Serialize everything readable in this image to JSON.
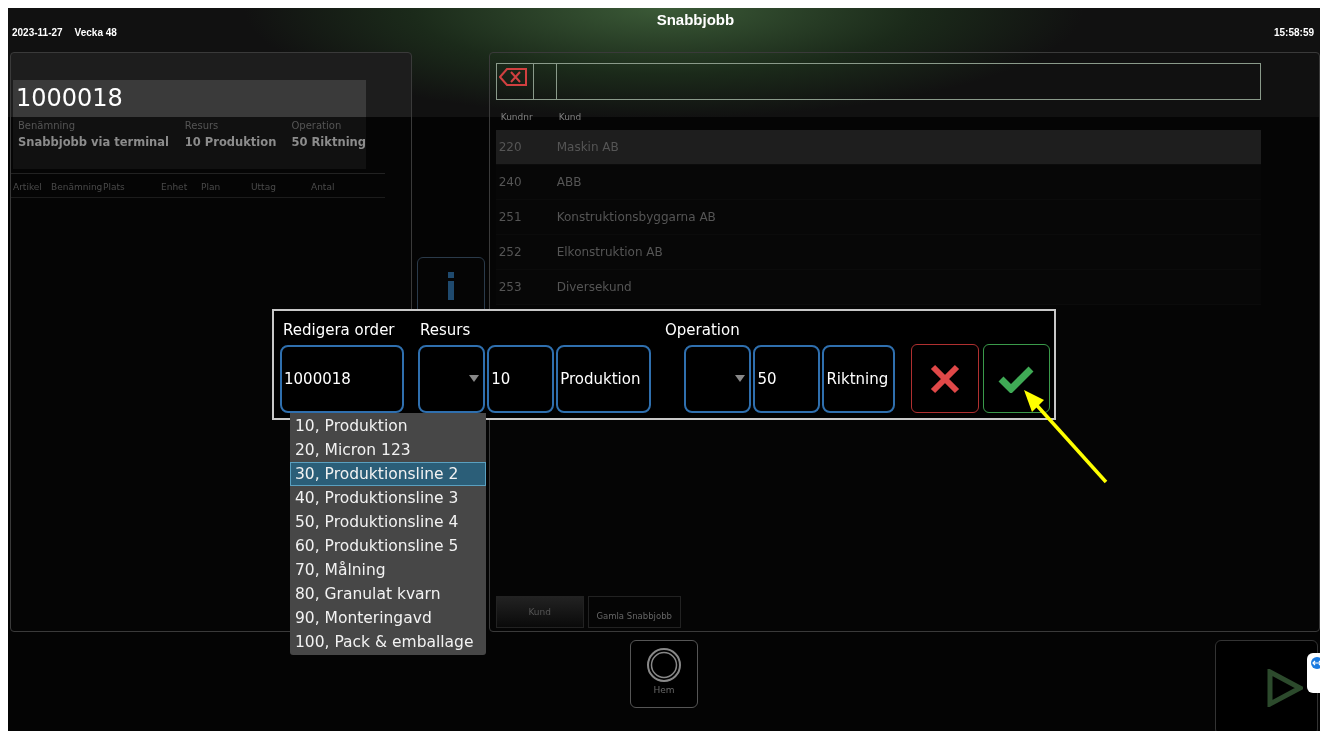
{
  "header": {
    "date": "2023-11-27",
    "week": "Vecka 48",
    "title": "Snabbjobb",
    "time": "15:58:59"
  },
  "order": {
    "number": "1000018",
    "fields": [
      {
        "label": "Benämning",
        "value": "Snabbjobb via terminal"
      },
      {
        "label": "Resurs",
        "value": "10 Produktion"
      },
      {
        "label": "Operation",
        "value": "50 Riktning"
      }
    ],
    "columns": [
      "Artikel",
      "Benämning",
      "Plats",
      "Enhet",
      "Plan",
      "Uttag",
      "Antal"
    ]
  },
  "customers": {
    "columns": [
      "Kundnr",
      "Kund"
    ],
    "rows": [
      {
        "number": "220",
        "name": "Maskin AB",
        "selected": true
      },
      {
        "number": "240",
        "name": "ABB",
        "selected": false
      },
      {
        "number": "251",
        "name": "Konstruktionsbyggarna AB",
        "selected": false
      },
      {
        "number": "252",
        "name": "Elkonstruktion AB",
        "selected": false
      },
      {
        "number": "253",
        "name": "Diversekund",
        "selected": false
      }
    ],
    "tabs": [
      {
        "label": "Kund",
        "selected": true
      },
      {
        "label": "Gamla Snabbjobb",
        "selected": false
      }
    ]
  },
  "dialog": {
    "order": {
      "label": "Redigera order",
      "value": "1000018"
    },
    "resource": {
      "label": "Resurs",
      "code": "10",
      "name": "Produktion",
      "open": true,
      "options": [
        {
          "label": "10, Produktion",
          "selected": false
        },
        {
          "label": "20, Micron 123",
          "selected": false
        },
        {
          "label": "30, Produktionsline 2",
          "selected": true
        },
        {
          "label": "40, Produktionsline 3",
          "selected": false
        },
        {
          "label": "50, Produktionsline 4",
          "selected": false
        },
        {
          "label": "60, Produktionsline 5",
          "selected": false
        },
        {
          "label": "70, Målning",
          "selected": false
        },
        {
          "label": "80, Granulat kvarn",
          "selected": false
        },
        {
          "label": "90, Monteringavd",
          "selected": false
        },
        {
          "label": "100, Pack & emballage",
          "selected": false
        }
      ]
    },
    "operation": {
      "label": "Operation",
      "code": "50",
      "name": "Riktning"
    }
  },
  "bottom": {
    "home": "Hem"
  }
}
